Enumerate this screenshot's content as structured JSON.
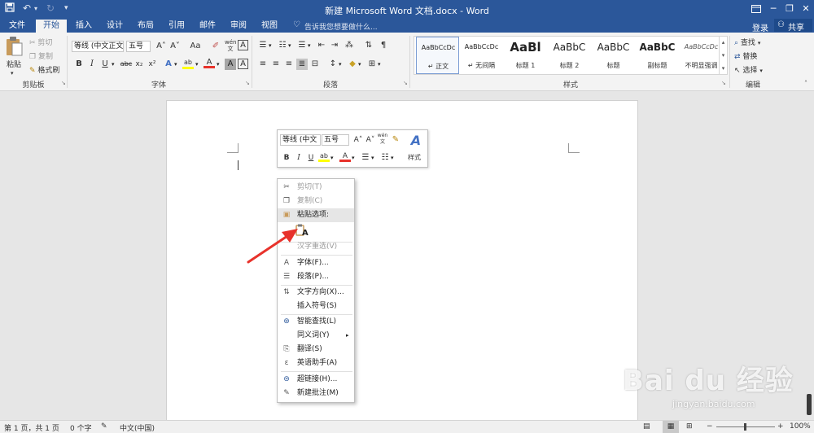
{
  "title_bar": {
    "title": "新建 Microsoft Word 文档.docx - Word",
    "save_icon": "save-icon",
    "undo_icon": "undo-icon",
    "redo_icon": "redo-icon",
    "qa_more": "▾",
    "ribbon_display_icon": "ribbon-display-icon",
    "minimize": "─",
    "restore": "❐",
    "close": "✕",
    "bg_color": "#2b579a"
  },
  "tabs": [
    {
      "label": "文件"
    },
    {
      "label": "开始",
      "active": true
    },
    {
      "label": "插入"
    },
    {
      "label": "设计"
    },
    {
      "label": "布局"
    },
    {
      "label": "引用"
    },
    {
      "label": "邮件"
    },
    {
      "label": "审阅"
    },
    {
      "label": "视图"
    }
  ],
  "tellme": "告诉我您想要做什么...",
  "login": "登录",
  "share": "共享",
  "ribbon": {
    "clipboard": {
      "group": "剪贴板",
      "paste": "粘贴",
      "cut": "剪切",
      "copy": "复制",
      "format_painter": "格式刷"
    },
    "font": {
      "group": "字体",
      "font_name": "等线 (中文正文)",
      "font_size": "五号",
      "grow": "A˄",
      "shrink": "A˅",
      "change_case": "Aa",
      "bold": "B",
      "italic": "I",
      "underline": "U",
      "strike": "abc",
      "subscript": "x₂",
      "superscript": "x²",
      "font_color": "A",
      "highlight": "ab",
      "char_shading": "A"
    },
    "paragraph": {
      "group": "段落"
    },
    "styles": {
      "group": "样式",
      "items": [
        {
          "sample": "AaBbCcDc",
          "name": "↵ 正文"
        },
        {
          "sample": "AaBbCcDc",
          "name": "↵ 无间隔"
        },
        {
          "sample": "AaBl",
          "name": "标题 1"
        },
        {
          "sample": "AaBbC",
          "name": "标题 2"
        },
        {
          "sample": "AaBbC",
          "name": "标题"
        },
        {
          "sample": "AaBbC",
          "name": "副标题"
        },
        {
          "sample": "AaBbCcDc",
          "name": "不明显强调"
        }
      ]
    },
    "editing": {
      "group": "编辑",
      "find": "查找",
      "replace": "替换",
      "select": "选择"
    }
  },
  "mini_toolbar": {
    "font_name": "等线 (中文",
    "font_size": "五号",
    "styles_label": "样式"
  },
  "context_menu": {
    "cut": "剪切(T)",
    "copy": "复制(C)",
    "paste_options": "粘贴选项:",
    "keep_text_only": "A",
    "text_reconvert": "汉字重选(V)",
    "font": "字体(F)...",
    "paragraph": "段落(P)...",
    "text_direction": "文字方向(X)...",
    "insert_symbol": "插入符号(S)",
    "smart_lookup": "智能查找(L)",
    "synonyms": "同义词(Y)",
    "translate": "翻译(S)",
    "english_assistant": "英语助手(A)",
    "hyperlink": "超链接(H)...",
    "new_comment": "新建批注(M)"
  },
  "status_bar": {
    "page": "第 1 页，共 1 页",
    "words": "0 个字",
    "language": "中文(中国)",
    "zoom": "100%",
    "zoom_minus": "−",
    "zoom_plus": "+"
  },
  "watermark": {
    "logo": "Bai du 经验",
    "url": "jingyan.baidu.com"
  },
  "colors": {
    "accent": "#2b579a",
    "arrow": "#e8322b",
    "font_color_bar": "#e8322b",
    "highlight_bar": "#ffff00"
  }
}
